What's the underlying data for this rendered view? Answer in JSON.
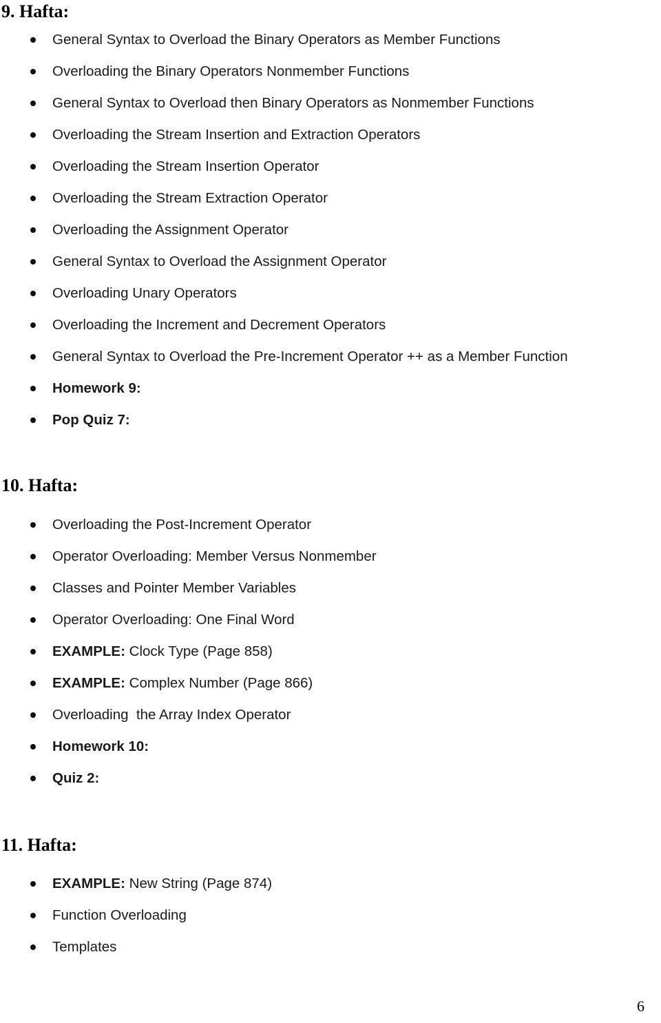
{
  "document": {
    "page_number": "6",
    "sections": [
      {
        "heading": "9. Hafta:",
        "items": [
          {
            "lead": "",
            "text": "General Syntax to Overload the Binary Operators as Member Functions",
            "bold": false
          },
          {
            "lead": "",
            "text": "Overloading the Binary Operators Nonmember Functions",
            "bold": false
          },
          {
            "lead": "",
            "text": "General Syntax to Overload then Binary Operators as Nonmember Functions",
            "bold": false
          },
          {
            "lead": "",
            "text": "Overloading the Stream Insertion and Extraction Operators",
            "bold": false
          },
          {
            "lead": "",
            "text": "Overloading the Stream Insertion Operator",
            "bold": false
          },
          {
            "lead": "",
            "text": "Overloading the Stream Extraction Operator",
            "bold": false
          },
          {
            "lead": "",
            "text": "Overloading the Assignment Operator",
            "bold": false
          },
          {
            "lead": "",
            "text": "General Syntax to Overload the Assignment Operator",
            "bold": false
          },
          {
            "lead": "",
            "text": "Overloading Unary Operators",
            "bold": false
          },
          {
            "lead": "",
            "text": "Overloading the Increment and Decrement Operators",
            "bold": false
          },
          {
            "lead": "",
            "text": "General Syntax to Overload the Pre-Increment Operator ++ as a Member Function",
            "bold": false
          },
          {
            "lead": "",
            "text": "Homework 9:",
            "bold": true
          },
          {
            "lead": "",
            "text": "Pop Quiz 7:",
            "bold": true
          }
        ]
      },
      {
        "heading": "10. Hafta:",
        "items": [
          {
            "lead": "",
            "text": "Overloading the Post-Increment Operator",
            "bold": false
          },
          {
            "lead": "",
            "text": "Operator Overloading: Member Versus Nonmember",
            "bold": false
          },
          {
            "lead": "",
            "text": "Classes and Pointer Member Variables",
            "bold": false
          },
          {
            "lead": "",
            "text": "Operator Overloading: One Final Word",
            "bold": false
          },
          {
            "lead": "EXAMPLE:",
            "text": " Clock Type (Page 858)",
            "bold": false
          },
          {
            "lead": "EXAMPLE:",
            "text": " Complex Number (Page 866)",
            "bold": false
          },
          {
            "lead": "",
            "text": "Overloading  the Array Index Operator",
            "bold": false
          },
          {
            "lead": "",
            "text": "Homework 10:",
            "bold": true
          },
          {
            "lead": "",
            "text": "Quiz 2:",
            "bold": true
          }
        ]
      },
      {
        "heading": "11. Hafta:",
        "items": [
          {
            "lead": "EXAMPLE:",
            "text": " New String (Page 874)",
            "bold": false
          },
          {
            "lead": "",
            "text": "Function Overloading",
            "bold": false
          },
          {
            "lead": "",
            "text": "Templates",
            "bold": false
          }
        ]
      }
    ]
  }
}
